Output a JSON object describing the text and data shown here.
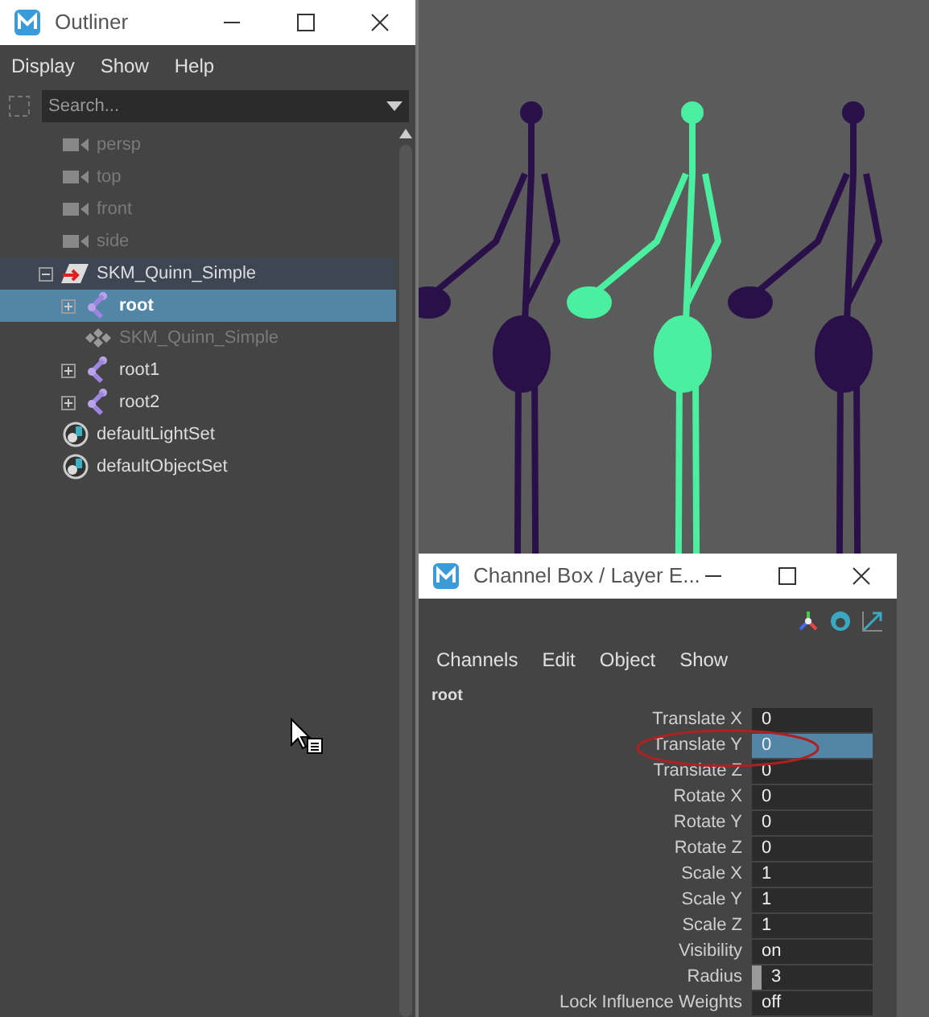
{
  "viewport": {
    "skeletons": [
      {
        "selected": false
      },
      {
        "selected": true
      },
      {
        "selected": false
      }
    ]
  },
  "outliner": {
    "title": "Outliner",
    "menu": [
      "Display",
      "Show",
      "Help"
    ],
    "search": {
      "placeholder": "Search..."
    },
    "items": [
      {
        "kind": "camera",
        "label": "persp",
        "dimmed": true,
        "selected": false
      },
      {
        "kind": "camera",
        "label": "top",
        "dimmed": true,
        "selected": false
      },
      {
        "kind": "camera",
        "label": "front",
        "dimmed": true,
        "selected": false
      },
      {
        "kind": "camera",
        "label": "side",
        "dimmed": true,
        "selected": false
      },
      {
        "kind": "transform",
        "label": "SKM_Quinn_Simple",
        "dimmed": false,
        "selected": false,
        "highlighted": true,
        "expanded": true,
        "children": [
          {
            "kind": "joint",
            "label": "root",
            "dimmed": false,
            "selected": true,
            "expanded": false
          },
          {
            "kind": "mesh",
            "label": "SKM_Quinn_Simple",
            "dimmed": true,
            "selected": false
          },
          {
            "kind": "joint",
            "label": "root1",
            "dimmed": false,
            "selected": false,
            "expanded": false
          },
          {
            "kind": "joint",
            "label": "root2",
            "dimmed": false,
            "selected": false,
            "expanded": false
          }
        ]
      },
      {
        "kind": "set",
        "label": "defaultLightSet",
        "dimmed": false,
        "selected": false
      },
      {
        "kind": "set",
        "label": "defaultObjectSet",
        "dimmed": false,
        "selected": false
      }
    ]
  },
  "channel_box": {
    "title": "Channel Box / Layer E...",
    "menu": [
      "Channels",
      "Edit",
      "Object",
      "Show"
    ],
    "node": "root",
    "channels": [
      {
        "name": "Translate X",
        "value": "0",
        "selected": false,
        "marker": false
      },
      {
        "name": "Translate Y",
        "value": "0",
        "selected": true,
        "marker": false
      },
      {
        "name": "Translate Z",
        "value": "0",
        "selected": false,
        "marker": false
      },
      {
        "name": "Rotate X",
        "value": "0",
        "selected": false,
        "marker": false
      },
      {
        "name": "Rotate Y",
        "value": "0",
        "selected": false,
        "marker": false
      },
      {
        "name": "Rotate Z",
        "value": "0",
        "selected": false,
        "marker": false
      },
      {
        "name": "Scale X",
        "value": "1",
        "selected": false,
        "marker": false
      },
      {
        "name": "Scale Y",
        "value": "1",
        "selected": false,
        "marker": false
      },
      {
        "name": "Scale Z",
        "value": "1",
        "selected": false,
        "marker": false
      },
      {
        "name": "Visibility",
        "value": "on",
        "selected": false,
        "marker": false
      },
      {
        "name": "Radius",
        "value": "3",
        "selected": false,
        "marker": true
      },
      {
        "name": "Lock Influence Weights",
        "value": "off",
        "selected": false,
        "marker": false
      }
    ]
  }
}
